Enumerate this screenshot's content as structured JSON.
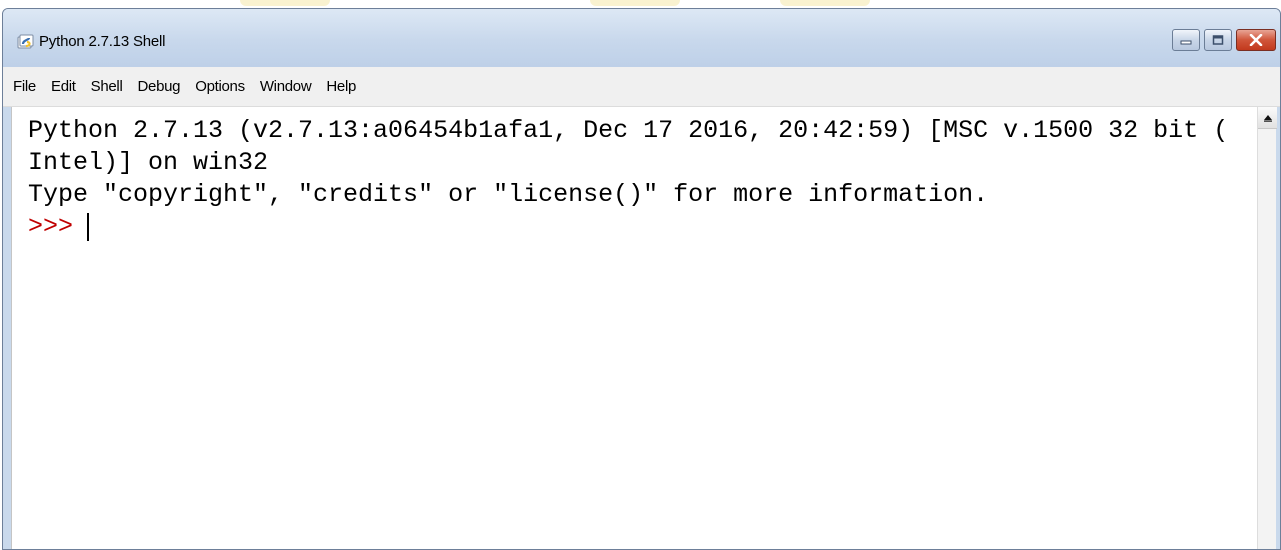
{
  "window": {
    "title": "Python 2.7.13 Shell",
    "icon": "python-idle-icon",
    "controls": {
      "minimize_icon": "minimize-icon",
      "maximize_icon": "maximize-icon",
      "close_icon": "close-icon"
    }
  },
  "menu": {
    "items": [
      {
        "label": "File"
      },
      {
        "label": "Edit"
      },
      {
        "label": "Shell"
      },
      {
        "label": "Debug"
      },
      {
        "label": "Options"
      },
      {
        "label": "Window"
      },
      {
        "label": "Help"
      }
    ]
  },
  "shell": {
    "lines": [
      "Python 2.7.13 (v2.7.13:a06454b1afa1, Dec 17 2016, 20:42:59) [MSC v.1500 32 bit (",
      "Intel)] on win32",
      "Type \"copyright\", \"credits\" or \"license()\" for more information."
    ],
    "prompt": ">>>"
  },
  "colors": {
    "prompt": "#c00000",
    "text": "#000000",
    "close_button": "#c2391d",
    "titlebar": "#c8d8ec"
  }
}
